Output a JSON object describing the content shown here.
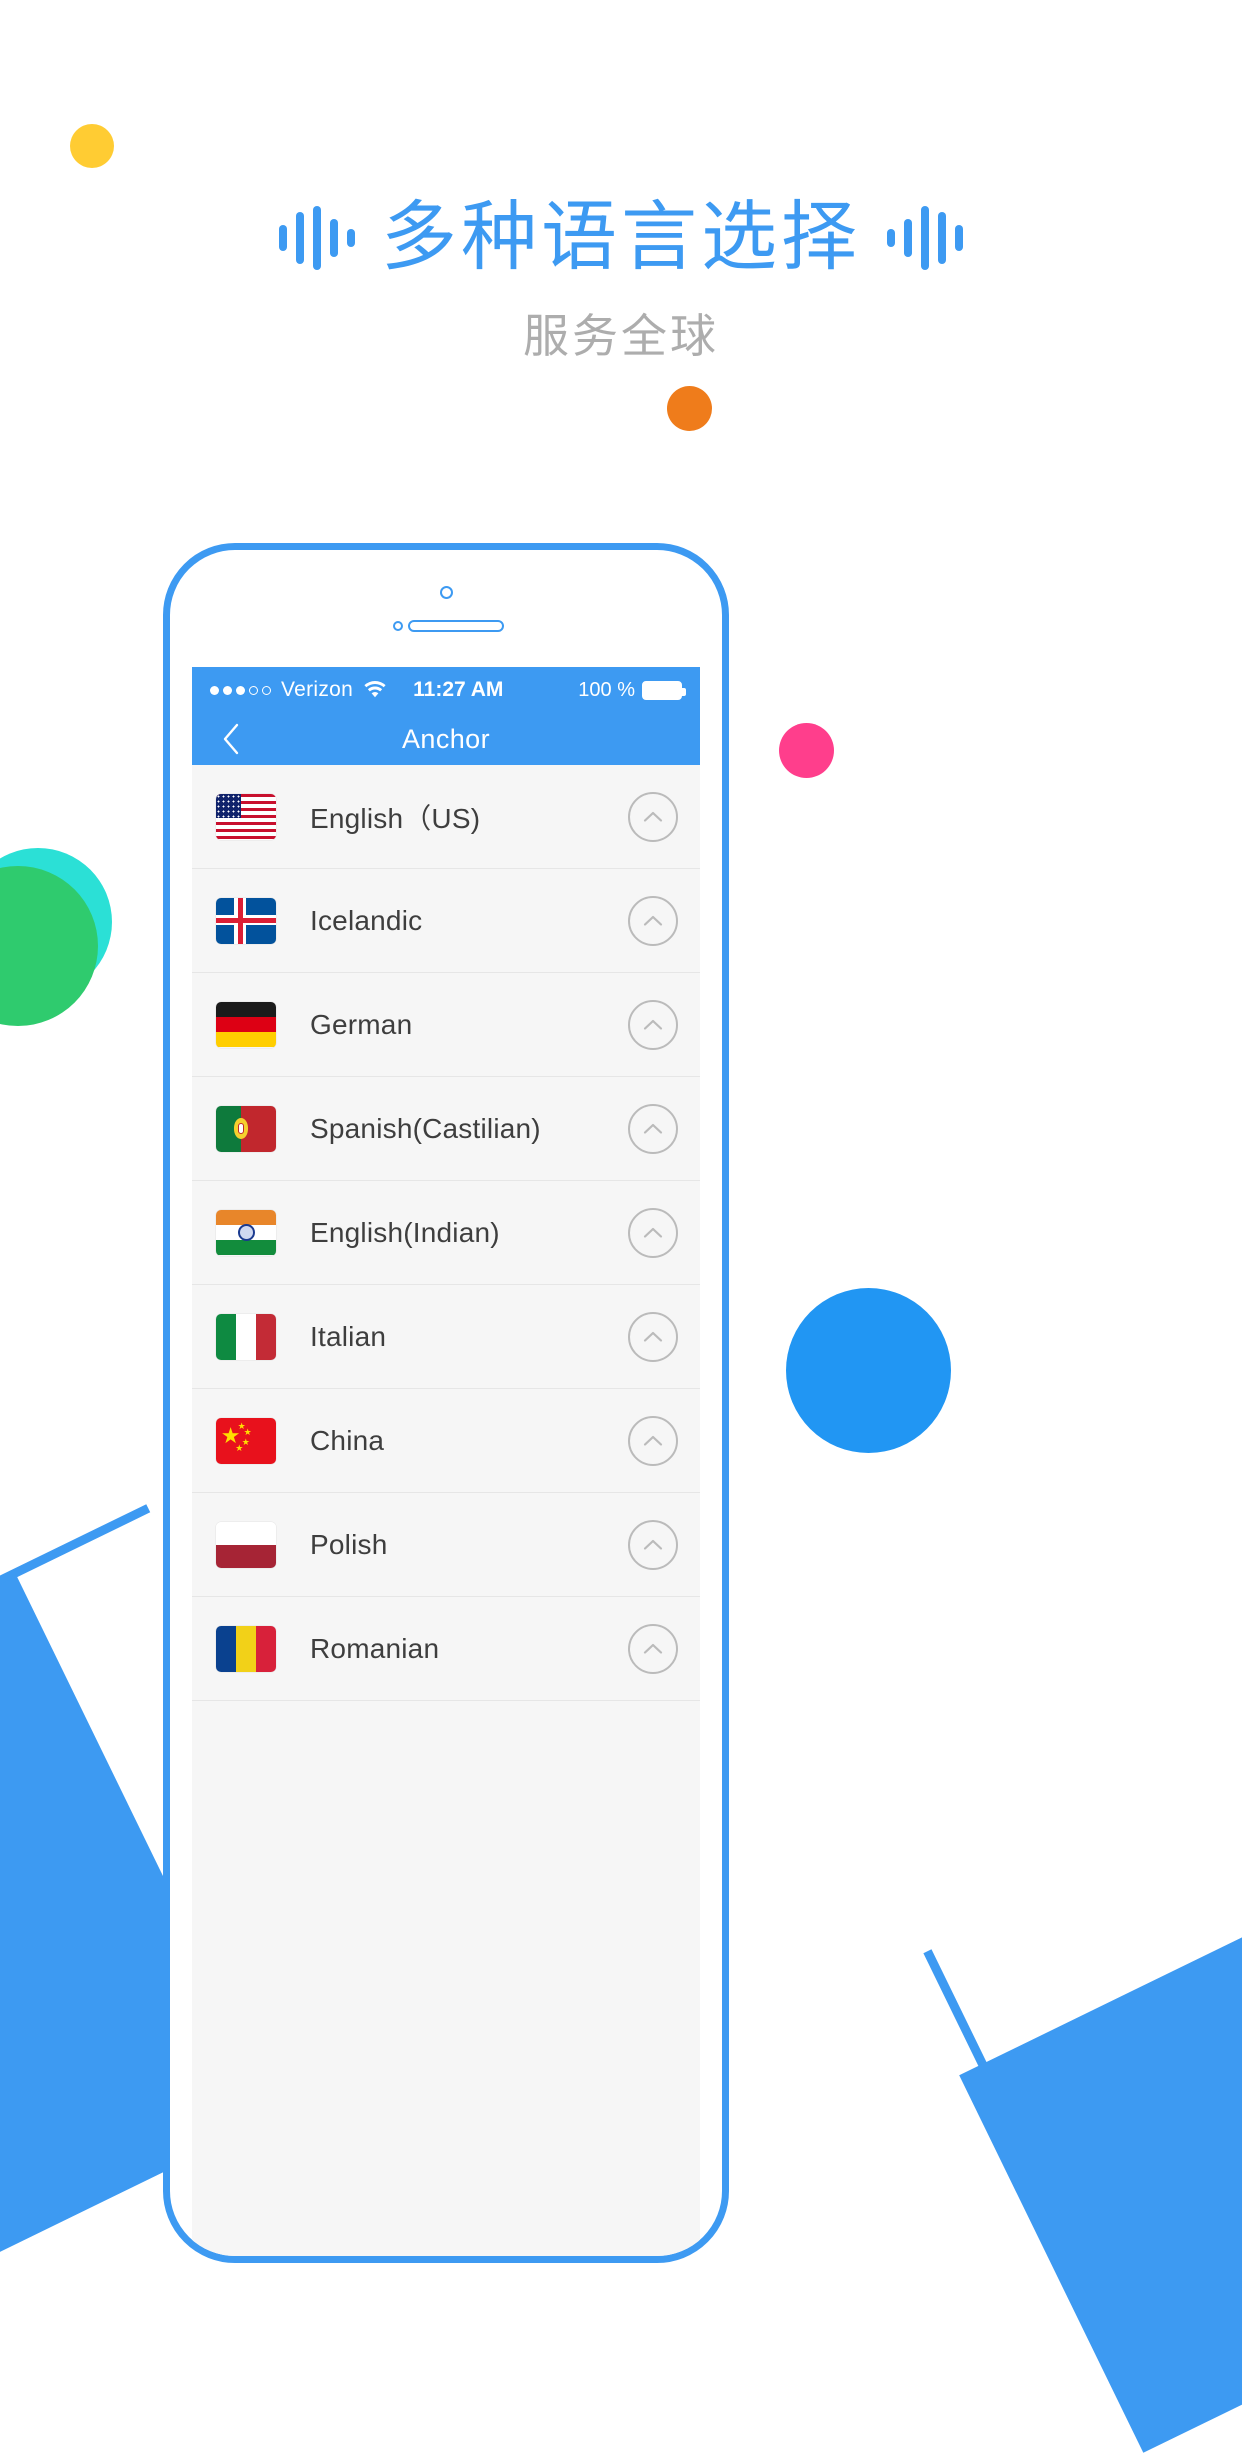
{
  "promo": {
    "headline": "多种语言选择",
    "subtitle": "服务全球",
    "accent_color": "#3D9AF2",
    "subtitle_color": "#ADADAD"
  },
  "decorations": [
    {
      "name": "yellow-dot",
      "color": "#FFCC33"
    },
    {
      "name": "orange-dot",
      "color": "#EF7C1B"
    },
    {
      "name": "pink-dot",
      "color": "#FF3E8C"
    },
    {
      "name": "teal-dot",
      "color": "#2BE0D6"
    },
    {
      "name": "green-dot",
      "color": "#2FCB6E"
    },
    {
      "name": "blue-dot",
      "color": "#2196F3"
    }
  ],
  "phone": {
    "status_bar": {
      "signal_dots_filled": 3,
      "signal_dots_total": 5,
      "carrier": "Verizon",
      "wifi_icon": "wifi-icon",
      "time": "11:27 AM",
      "battery_percent": "100 %",
      "battery_icon": "battery-full-icon"
    },
    "nav_bar": {
      "back_icon": "chevron-left-icon",
      "title": "Anchor"
    },
    "list": {
      "accessory_icon": "chevron-up-circle-icon",
      "items": [
        {
          "label": "English（US)",
          "flag": "flag-us",
          "flag_name": "flag-united-states"
        },
        {
          "label": "Icelandic",
          "flag": "flag-is",
          "flag_name": "flag-iceland"
        },
        {
          "label": "German",
          "flag": "flag-de",
          "flag_name": "flag-germany"
        },
        {
          "label": "Spanish(Castilian)",
          "flag": "flag-pt",
          "flag_name": "flag-portugal"
        },
        {
          "label": "English(Indian)",
          "flag": "flag-in",
          "flag_name": "flag-india"
        },
        {
          "label": "Italian",
          "flag": "flag-it",
          "flag_name": "flag-italy"
        },
        {
          "label": "China",
          "flag": "flag-cn",
          "flag_name": "flag-china"
        },
        {
          "label": "Polish",
          "flag": "flag-pl",
          "flag_name": "flag-poland"
        },
        {
          "label": "Romanian",
          "flag": "flag-ro",
          "flag_name": "flag-romania"
        }
      ]
    }
  }
}
